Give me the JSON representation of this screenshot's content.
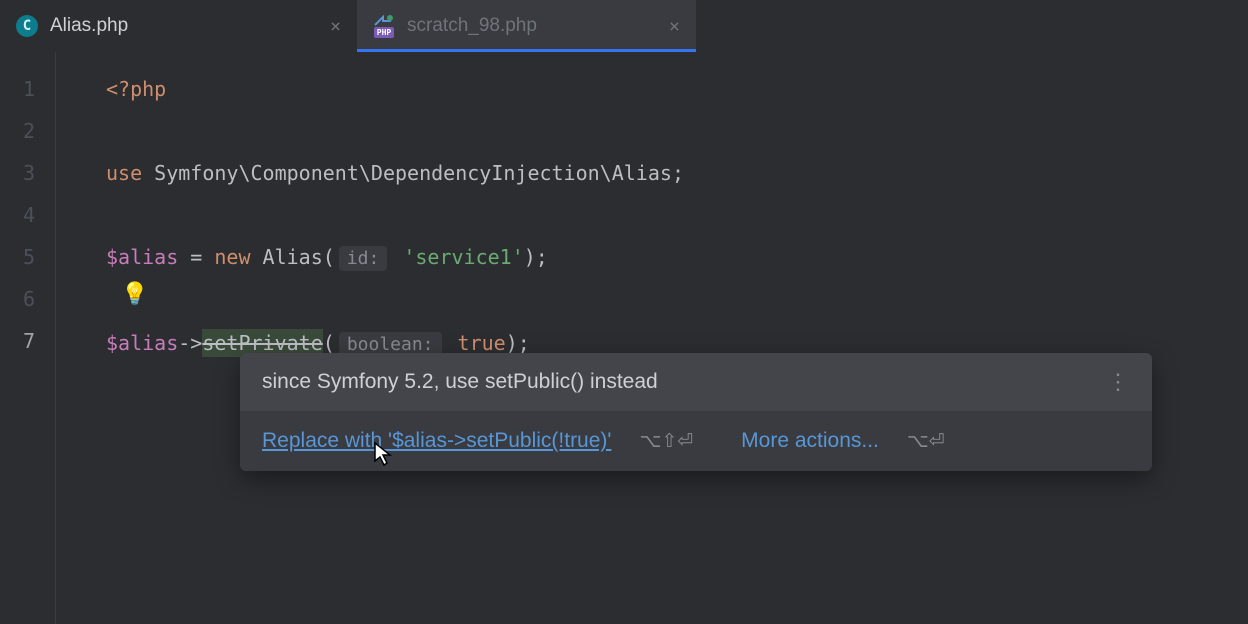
{
  "tabs": [
    {
      "label": "Alias.php",
      "active": false,
      "icon": "c"
    },
    {
      "label": "scratch_98.php",
      "active": true,
      "icon": "php"
    }
  ],
  "gutter_lines": [
    "1",
    "2",
    "3",
    "4",
    "5",
    "6",
    "7"
  ],
  "current_line": "7",
  "code": {
    "line1": {
      "open": "<?php"
    },
    "line3": {
      "use": "use",
      "ns": " Symfony\\Component\\DependencyInjection\\Alias",
      "semi": ";"
    },
    "line5": {
      "var": "$alias",
      "eq": " = ",
      "new": "new",
      "cls": " Alias",
      "open": "(",
      "hint": "id:",
      "str": " 'service1'",
      "close": ");"
    },
    "line7": {
      "var": "$alias",
      "arrow": "->",
      "method": "setPrivate",
      "open": "(",
      "hint": "boolean:",
      "kw": " true",
      "close": ");"
    }
  },
  "bulb": "💡",
  "popup": {
    "message": "since Symfony 5.2, use setPublic() instead",
    "quick_fix": "Replace with '$alias->setPublic(!true)'",
    "shortcut1": "⌥⇧⏎",
    "more_actions": "More actions...",
    "shortcut2": "⌥⏎",
    "menu_icon": "⋮"
  }
}
